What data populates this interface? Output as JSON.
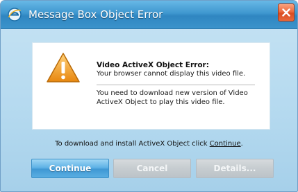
{
  "window": {
    "title": "Message Box Object Error",
    "title_icon": "internet-explorer-icon",
    "close_icon": "close-icon"
  },
  "message": {
    "icon": "warning-triangle-icon",
    "title": "Video ActiveX Object Error:",
    "line1": "Your browser cannot display this video file.",
    "line2": "You need to download new version of Video ActiveX Object to play this video file."
  },
  "instruction": {
    "text": "To download and install ActiveX Object click ",
    "link": "Continue",
    "suffix": "."
  },
  "buttons": {
    "continue": "Continue",
    "cancel": "Cancel",
    "details": "Details..."
  },
  "colors": {
    "titlebar": "#3f97cf",
    "close_button": "#e3582c",
    "primary_button": "#4aa3db",
    "disabled_button": "#c6ccd0",
    "warning_icon": "#f2a020"
  }
}
